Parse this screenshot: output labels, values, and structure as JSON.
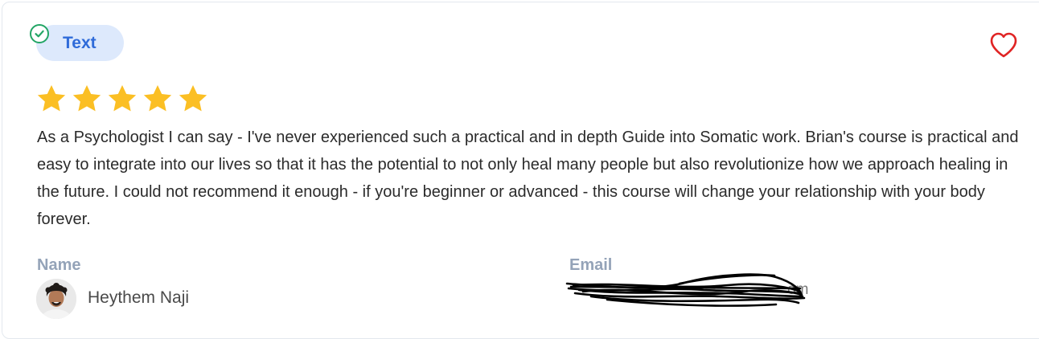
{
  "review": {
    "type_label": "Text",
    "rating": 5,
    "max_rating": 5,
    "text": "As a Psychologist I can say - I've never experienced such a practical and in depth Guide into Somatic work. Brian's course is practical and easy to integrate into our lives so that it has the potential to not only heal many people but also revolutionize how we approach healing in the future. I could not recommend it enough - if you're beginner or advanced - this course will change your relationship with your body forever.",
    "name_label": "Name",
    "name": "Heythem Naji",
    "email_label": "Email",
    "email_visible_suffix": "om"
  },
  "icons": {
    "verified": "check-circle-icon",
    "favorite": "heart-outline-icon",
    "star": "star-icon"
  },
  "colors": {
    "star": "#fbbf24",
    "heart": "#e02424",
    "verified": "#22a565",
    "pill_bg": "#dde9fc",
    "pill_text": "#2f6bd9",
    "label": "#94a3b8"
  }
}
